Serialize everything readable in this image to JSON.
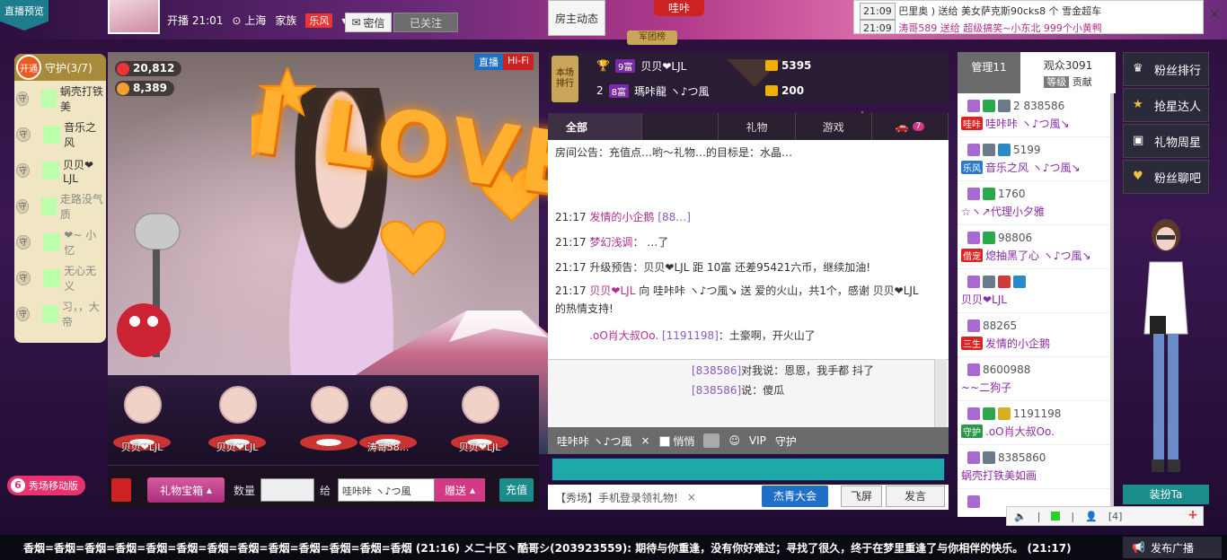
{
  "topbar": {
    "preview_tag": "直播预览",
    "host_time": "开播 21:01",
    "host_city": "上海",
    "family_label": "家族",
    "family_badge": "乐风",
    "msg_btn": "密信",
    "follow_btn": "已关注",
    "host_dynamic_btn": "房主动态",
    "brand": "哇咔",
    "army_rank": "军团榜",
    "notice_line1_time": "21:09",
    "notice_line1_text": "巴里奥 ) 送给 美女萨克斯90cks8 个 雪金超车",
    "notice_line2_time": "21:09",
    "notice_line2_user": "涛哥589",
    "notice_line2_text": "送给 超级搞笑~小东北 999个小黄鸭",
    "notice_close": "×"
  },
  "guard": {
    "open_btn": "开通",
    "title": "守护(3/7)",
    "items": [
      {
        "label": "蜗壳打铁美",
        "dim": false
      },
      {
        "label": "音乐之风",
        "dim": false
      },
      {
        "label": "贝贝❤LJL",
        "dim": false
      },
      {
        "label": "走路没气质",
        "dim": true
      },
      {
        "label": "❤~ 小忆",
        "dim": true
      },
      {
        "label": "无心无义",
        "dim": true
      },
      {
        "label": "习，，大帝",
        "dim": true
      }
    ],
    "shield": "守"
  },
  "video": {
    "stat1": "20,812",
    "stat2": "8,389",
    "live_label": "直播",
    "hifi_label": "Hi-Fi",
    "overlay_text": "I LOVE YOU!"
  },
  "seats": [
    {
      "name": "贝贝❤LJL"
    },
    {
      "name": "贝贝❤LJL"
    },
    {
      "name": ""
    },
    {
      "name": "涛哥58..."
    },
    {
      "name": "贝贝❤LJL"
    }
  ],
  "gift_bar": {
    "gift_box": "礼物宝箱",
    "qty_label": "数量",
    "give_label": "给",
    "to_user": "哇咔咔 ヽ♪つ風",
    "send_btn": "赠送",
    "recharge_btn": "充值"
  },
  "mobile_promo": "秀场移动版",
  "chat": {
    "room_rank": "本场\n排行",
    "rank1_badge": "9富",
    "rank1_name": "贝贝❤LJL",
    "rank1_value": "5395",
    "rank2_num": "2",
    "rank2_badge": "8富",
    "rank2_name": "瑪咔龍 ヽ♪つ風",
    "rank2_value": "200",
    "tabs": [
      "全部",
      "",
      "礼物",
      "游戏",
      ""
    ],
    "tab_count": "7",
    "lines": [
      {
        "time": "",
        "text": "房间公告：充值点…哟～礼物…的目标是：水晶…"
      },
      {
        "time": "21:17",
        "user": "发情的小企鹅",
        "uid": "[88…]",
        "text": ""
      },
      {
        "time": "21:17",
        "user": "梦幻浅调",
        "uid": "：",
        "text": "…了"
      },
      {
        "time": "21:17",
        "user": "",
        "uid": "",
        "text": "升级预告：贝贝❤LJL 距 10富 还差95421六币，继续加油!"
      },
      {
        "time": "21:17",
        "user": "贝贝❤LJL",
        "uid": "",
        "text": "向 哇咔咔 ヽ♪つ風↘ 送 爱的火山，共1个，感谢 贝贝❤LJL 的热情支持!"
      },
      {
        "time": "",
        "user": ".oO肖大叔Oo.",
        "uid": "[1191198]",
        "text": "：土豪啊，开火山了"
      }
    ],
    "lines2": [
      {
        "uid": "[838586]",
        "text": "对我说：恩恩，我手都 抖了"
      },
      {
        "uid": "[838586]",
        "text": "说：傻瓜"
      }
    ],
    "opt_user": "哇咔咔 ヽ♪つ風",
    "opt_quiet": "悄悄",
    "opt_vip": "VIP",
    "opt_guard": "守护",
    "promo": "【秀场】手机登录领礼物!",
    "promo_close": "×",
    "jieqing_btn": "杰青大会",
    "fly_btn": "飞屏",
    "speak_btn": "发言"
  },
  "audience": {
    "manage_tab": "管理11",
    "viewers_tab": "观众3091",
    "grade_label": "等级",
    "contrib_label": "贡献",
    "items": [
      {
        "row1": "2 838586",
        "tag": "哇咔",
        "name": "哇咔咔 ヽ♪つ風↘"
      },
      {
        "row1": "5199",
        "tag": "乐风",
        "name": "音乐之风 ヽ♪つ風↘"
      },
      {
        "row1": "1760",
        "tag": "",
        "name": "☆ヽ↗代理小夕雅"
      },
      {
        "row1": "98806",
        "tag": "借宠",
        "name": "熄抽黑了心 ヽ♪つ風↘"
      },
      {
        "row1": "",
        "tag": "",
        "name": "贝贝❤LJL"
      },
      {
        "row1": "88265",
        "tag": "三生",
        "name": "发情的小企鹅"
      },
      {
        "row1": "8600988",
        "tag": "",
        "name": "~~二狗子"
      },
      {
        "row1": "1191198",
        "tag": "守护",
        "name": ".oO肖大叔Oo."
      },
      {
        "row1": "8385860",
        "tag": "",
        "name": "蜗壳打铁美如画"
      },
      {
        "row1": "",
        "tag": "",
        "name": ""
      }
    ]
  },
  "rail": {
    "fans_rank": "粉丝排行",
    "grab_star": "抢星达人",
    "gift_week": "礼物周星",
    "fans_chat": "粉丝聊吧",
    "dress_btn": "装扮Ta",
    "audio_count": "[4]",
    "plus": "+"
  },
  "ticker": {
    "text": "香烟=香烟=香烟=香烟=香烟=香烟=香烟=香烟=香烟=香烟=香烟=香烟=香烟  (21:16)   メ二十区丶酷哥シ(203923559): 期待与你重逢，没有你好难过；寻找了很久，终于在梦里重逢了与你相伴的快乐。  (21:17)",
    "broadcast_btn": "发布广播"
  }
}
